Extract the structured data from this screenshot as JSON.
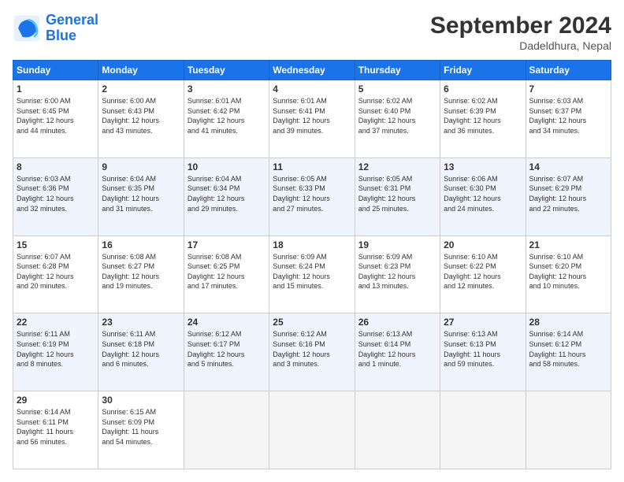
{
  "logo": {
    "line1": "General",
    "line2": "Blue"
  },
  "title": "September 2024",
  "subtitle": "Dadeldhura, Nepal",
  "weekdays": [
    "Sunday",
    "Monday",
    "Tuesday",
    "Wednesday",
    "Thursday",
    "Friday",
    "Saturday"
  ],
  "weeks": [
    [
      {
        "day": "1",
        "sunrise": "6:00 AM",
        "sunset": "6:45 PM",
        "daylight": "12 hours and 44 minutes."
      },
      {
        "day": "2",
        "sunrise": "6:00 AM",
        "sunset": "6:43 PM",
        "daylight": "12 hours and 43 minutes."
      },
      {
        "day": "3",
        "sunrise": "6:01 AM",
        "sunset": "6:42 PM",
        "daylight": "12 hours and 41 minutes."
      },
      {
        "day": "4",
        "sunrise": "6:01 AM",
        "sunset": "6:41 PM",
        "daylight": "12 hours and 39 minutes."
      },
      {
        "day": "5",
        "sunrise": "6:02 AM",
        "sunset": "6:40 PM",
        "daylight": "12 hours and 37 minutes."
      },
      {
        "day": "6",
        "sunrise": "6:02 AM",
        "sunset": "6:39 PM",
        "daylight": "12 hours and 36 minutes."
      },
      {
        "day": "7",
        "sunrise": "6:03 AM",
        "sunset": "6:37 PM",
        "daylight": "12 hours and 34 minutes."
      }
    ],
    [
      {
        "day": "8",
        "sunrise": "6:03 AM",
        "sunset": "6:36 PM",
        "daylight": "12 hours and 32 minutes."
      },
      {
        "day": "9",
        "sunrise": "6:04 AM",
        "sunset": "6:35 PM",
        "daylight": "12 hours and 31 minutes."
      },
      {
        "day": "10",
        "sunrise": "6:04 AM",
        "sunset": "6:34 PM",
        "daylight": "12 hours and 29 minutes."
      },
      {
        "day": "11",
        "sunrise": "6:05 AM",
        "sunset": "6:33 PM",
        "daylight": "12 hours and 27 minutes."
      },
      {
        "day": "12",
        "sunrise": "6:05 AM",
        "sunset": "6:31 PM",
        "daylight": "12 hours and 25 minutes."
      },
      {
        "day": "13",
        "sunrise": "6:06 AM",
        "sunset": "6:30 PM",
        "daylight": "12 hours and 24 minutes."
      },
      {
        "day": "14",
        "sunrise": "6:07 AM",
        "sunset": "6:29 PM",
        "daylight": "12 hours and 22 minutes."
      }
    ],
    [
      {
        "day": "15",
        "sunrise": "6:07 AM",
        "sunset": "6:28 PM",
        "daylight": "12 hours and 20 minutes."
      },
      {
        "day": "16",
        "sunrise": "6:08 AM",
        "sunset": "6:27 PM",
        "daylight": "12 hours and 19 minutes."
      },
      {
        "day": "17",
        "sunrise": "6:08 AM",
        "sunset": "6:25 PM",
        "daylight": "12 hours and 17 minutes."
      },
      {
        "day": "18",
        "sunrise": "6:09 AM",
        "sunset": "6:24 PM",
        "daylight": "12 hours and 15 minutes."
      },
      {
        "day": "19",
        "sunrise": "6:09 AM",
        "sunset": "6:23 PM",
        "daylight": "12 hours and 13 minutes."
      },
      {
        "day": "20",
        "sunrise": "6:10 AM",
        "sunset": "6:22 PM",
        "daylight": "12 hours and 12 minutes."
      },
      {
        "day": "21",
        "sunrise": "6:10 AM",
        "sunset": "6:20 PM",
        "daylight": "12 hours and 10 minutes."
      }
    ],
    [
      {
        "day": "22",
        "sunrise": "6:11 AM",
        "sunset": "6:19 PM",
        "daylight": "12 hours and 8 minutes."
      },
      {
        "day": "23",
        "sunrise": "6:11 AM",
        "sunset": "6:18 PM",
        "daylight": "12 hours and 6 minutes."
      },
      {
        "day": "24",
        "sunrise": "6:12 AM",
        "sunset": "6:17 PM",
        "daylight": "12 hours and 5 minutes."
      },
      {
        "day": "25",
        "sunrise": "6:12 AM",
        "sunset": "6:16 PM",
        "daylight": "12 hours and 3 minutes."
      },
      {
        "day": "26",
        "sunrise": "6:13 AM",
        "sunset": "6:14 PM",
        "daylight": "12 hours and 1 minute."
      },
      {
        "day": "27",
        "sunrise": "6:13 AM",
        "sunset": "6:13 PM",
        "daylight": "11 hours and 59 minutes."
      },
      {
        "day": "28",
        "sunrise": "6:14 AM",
        "sunset": "6:12 PM",
        "daylight": "11 hours and 58 minutes."
      }
    ],
    [
      {
        "day": "29",
        "sunrise": "6:14 AM",
        "sunset": "6:11 PM",
        "daylight": "11 hours and 56 minutes."
      },
      {
        "day": "30",
        "sunrise": "6:15 AM",
        "sunset": "6:09 PM",
        "daylight": "11 hours and 54 minutes."
      },
      null,
      null,
      null,
      null,
      null
    ]
  ]
}
